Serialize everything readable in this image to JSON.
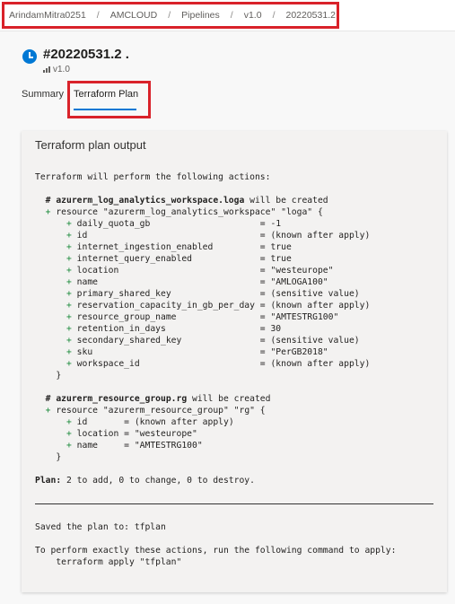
{
  "breadcrumb": {
    "items": [
      "ArindamMitra0251",
      "AMCLOUD",
      "Pipelines",
      "v1.0",
      "20220531.2"
    ],
    "separator": "/"
  },
  "run": {
    "title": "#20220531.2 .",
    "pipeline": "v1.0",
    "status_icon": "clock-icon"
  },
  "tabs": {
    "summary": "Summary",
    "terraform_plan": "Terraform Plan",
    "active": "terraform_plan"
  },
  "colors": {
    "accent": "#0078d4",
    "highlight": "#d9222a",
    "plus": "#1a8a3a"
  },
  "panel": {
    "title": "Terraform plan output"
  },
  "output": {
    "intro": "Terraform will perform the following actions:",
    "resource1": {
      "comment_hash": "  # ",
      "comment_name": "azurerm_log_analytics_workspace.loga",
      "comment_suffix": " will be created",
      "decl": "resource \"azurerm_log_analytics_workspace\" \"loga\" {",
      "attrs": [
        [
          "daily_quota_gb                    ",
          "= -1"
        ],
        [
          "id                                ",
          "= (known after apply)"
        ],
        [
          "internet_ingestion_enabled        ",
          "= true"
        ],
        [
          "internet_query_enabled            ",
          "= true"
        ],
        [
          "location                          ",
          "= \"westeurope\""
        ],
        [
          "name                              ",
          "= \"AMLOGA100\""
        ],
        [
          "primary_shared_key                ",
          "= (sensitive value)"
        ],
        [
          "reservation_capacity_in_gb_per_day",
          "= (known after apply)"
        ],
        [
          "resource_group_name               ",
          "= \"AMTESTRG100\""
        ],
        [
          "retention_in_days                 ",
          "= 30"
        ],
        [
          "secondary_shared_key              ",
          "= (sensitive value)"
        ],
        [
          "sku                               ",
          "= \"PerGB2018\""
        ],
        [
          "workspace_id                      ",
          "= (known after apply)"
        ]
      ]
    },
    "resource2": {
      "comment_hash": "  # ",
      "comment_name": "azurerm_resource_group.rg",
      "comment_suffix": " will be created",
      "decl": "resource \"azurerm_resource_group\" \"rg\" {",
      "attrs": [
        [
          "id      ",
          "= (known after apply)"
        ],
        [
          "location",
          "= \"westeurope\""
        ],
        [
          "name    ",
          "= \"AMTESTRG100\""
        ]
      ]
    },
    "close_brace": "}",
    "plus": "+",
    "plan_label": "Plan:",
    "plan_text": " 2 to add, 0 to change, 0 to destroy.",
    "saved": "Saved the plan to: tfplan",
    "perform": "To perform exactly these actions, run the following command to apply:",
    "command": "    terraform apply \"tfplan\""
  }
}
